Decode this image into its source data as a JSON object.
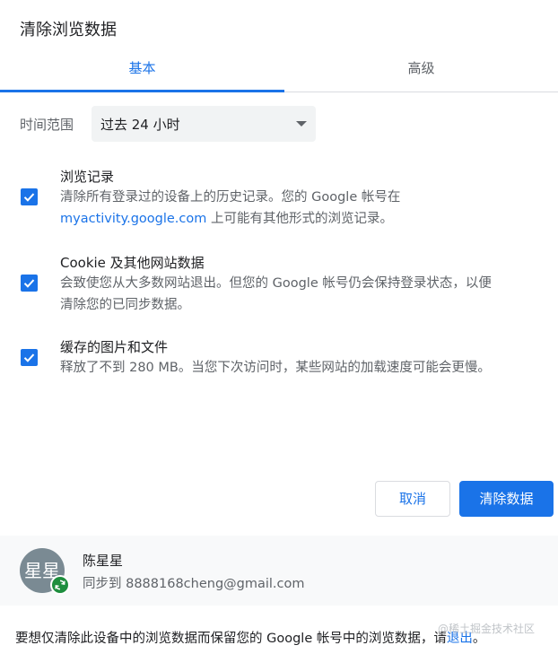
{
  "dialog": {
    "title": "清除浏览数据"
  },
  "tabs": [
    {
      "label": "基本"
    },
    {
      "label": "高级"
    }
  ],
  "time_range": {
    "label": "时间范围",
    "value": "过去 24 小时"
  },
  "options": [
    {
      "title": "浏览记录",
      "desc_line1": "清除所有登录过的设备上的历史记录。您的 Google 帐号在",
      "desc_link": "myactivity.google.com",
      "desc_line2": " 上可能有其他形式的浏览记录。",
      "checked": true
    },
    {
      "title": "Cookie 及其他网站数据",
      "desc_line1": "会致使您从大多数网站退出。但您的 Google 帐号仍会保持登录状态，以便",
      "desc_line2": "清除您的已同步数据。",
      "checked": true
    },
    {
      "title": "缓存的图片和文件",
      "desc_line1": "释放了不到 280 MB。当您下次访问时，某些网站的加载速度可能会更慢。",
      "checked": true
    }
  ],
  "buttons": {
    "cancel": "取消",
    "clear": "清除数据"
  },
  "account": {
    "avatar_text": "星星",
    "name": "陈星星",
    "sync_text": "同步到 8888168cheng@gmail.com",
    "badge_icon": "sync-icon"
  },
  "footer": {
    "text": "要想仅清除此设备中的浏览数据而保留您的 Google 帐号中的浏览数据，请",
    "link": "退出",
    "end": "。"
  },
  "watermark": "@稀土掘金技术社区",
  "colors": {
    "accent": "#1a73e8",
    "sync_green": "#1e8e3e",
    "text": "#202124",
    "secondary": "#5f6368"
  }
}
